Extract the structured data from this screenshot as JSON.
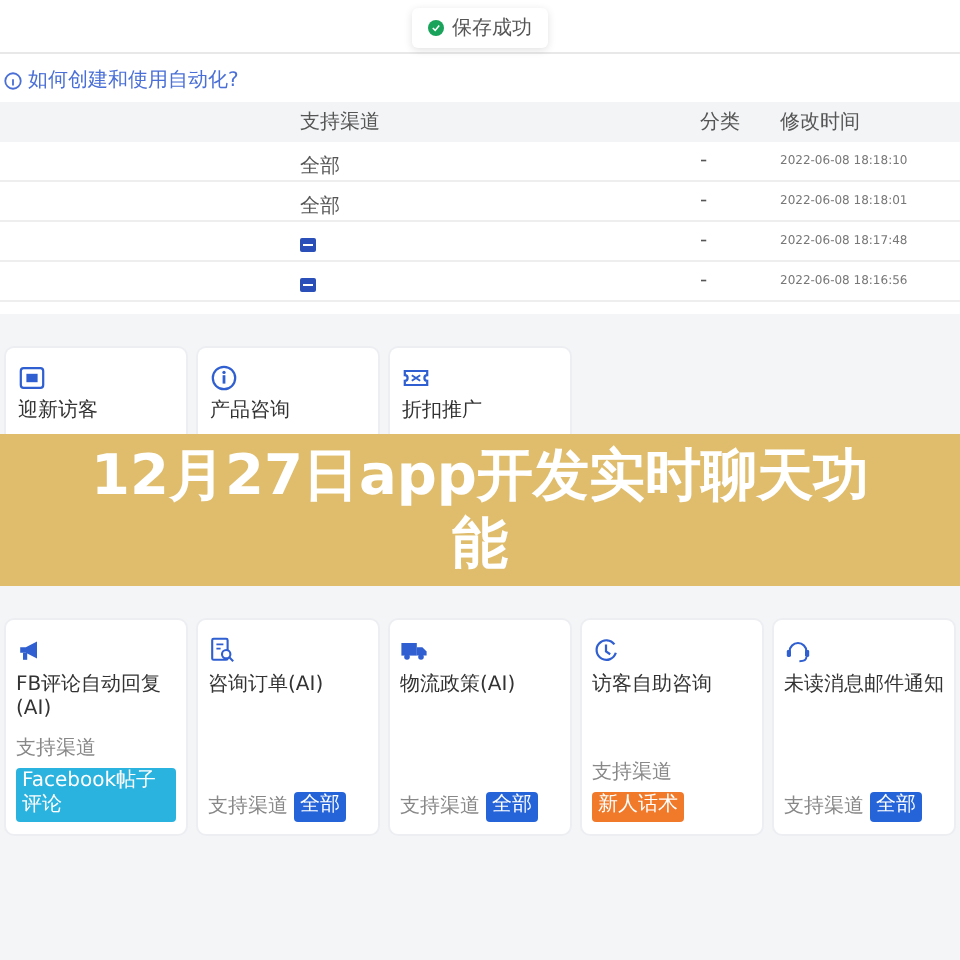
{
  "toast": {
    "text": "保存成功"
  },
  "help_link": {
    "text": "如何创建和使用自动化?"
  },
  "table": {
    "columns": [
      "支持渠道",
      "分类",
      "修改时间"
    ],
    "rows": [
      {
        "channel": {
          "kind": "text",
          "text": "全部"
        },
        "category": "-",
        "modified": "2022-06-08 18:18:10"
      },
      {
        "channel": {
          "kind": "text",
          "text": "全部"
        },
        "category": "-",
        "modified": "2022-06-08 18:18:01"
      },
      {
        "channel": {
          "kind": "icon"
        },
        "category": "-",
        "modified": "2022-06-08 18:17:48"
      },
      {
        "channel": {
          "kind": "icon"
        },
        "category": "-",
        "modified": "2022-06-08 18:16:56"
      }
    ]
  },
  "top_cards": [
    {
      "title": "迎新访客"
    },
    {
      "title": "产品咨询"
    },
    {
      "title": "折扣推广"
    }
  ],
  "banner": {
    "title": "12月27日app开发实时聊天功能"
  },
  "bottom_cards": [
    {
      "title": "FB评论自动回复(AI)",
      "channel_label": "支持渠道",
      "tag": {
        "text": "Facebook帖子评论",
        "color": "#2bb3e0"
      }
    },
    {
      "title": "咨询订单(AI)",
      "channel_label": "支持渠道",
      "tag": {
        "text": "全部",
        "color": "#2563d9"
      }
    },
    {
      "title": "物流政策(AI)",
      "channel_label": "支持渠道",
      "tag": {
        "text": "全部",
        "color": "#2563d9"
      }
    },
    {
      "title": "访客自助咨询",
      "channel_label": "支持渠道",
      "tag": {
        "text": "新人话术",
        "color": "#f07a2a"
      }
    },
    {
      "title": "未读消息邮件通知",
      "channel_label": "支持渠道",
      "tag": {
        "text": "全部",
        "color": "#2563d9"
      }
    }
  ]
}
